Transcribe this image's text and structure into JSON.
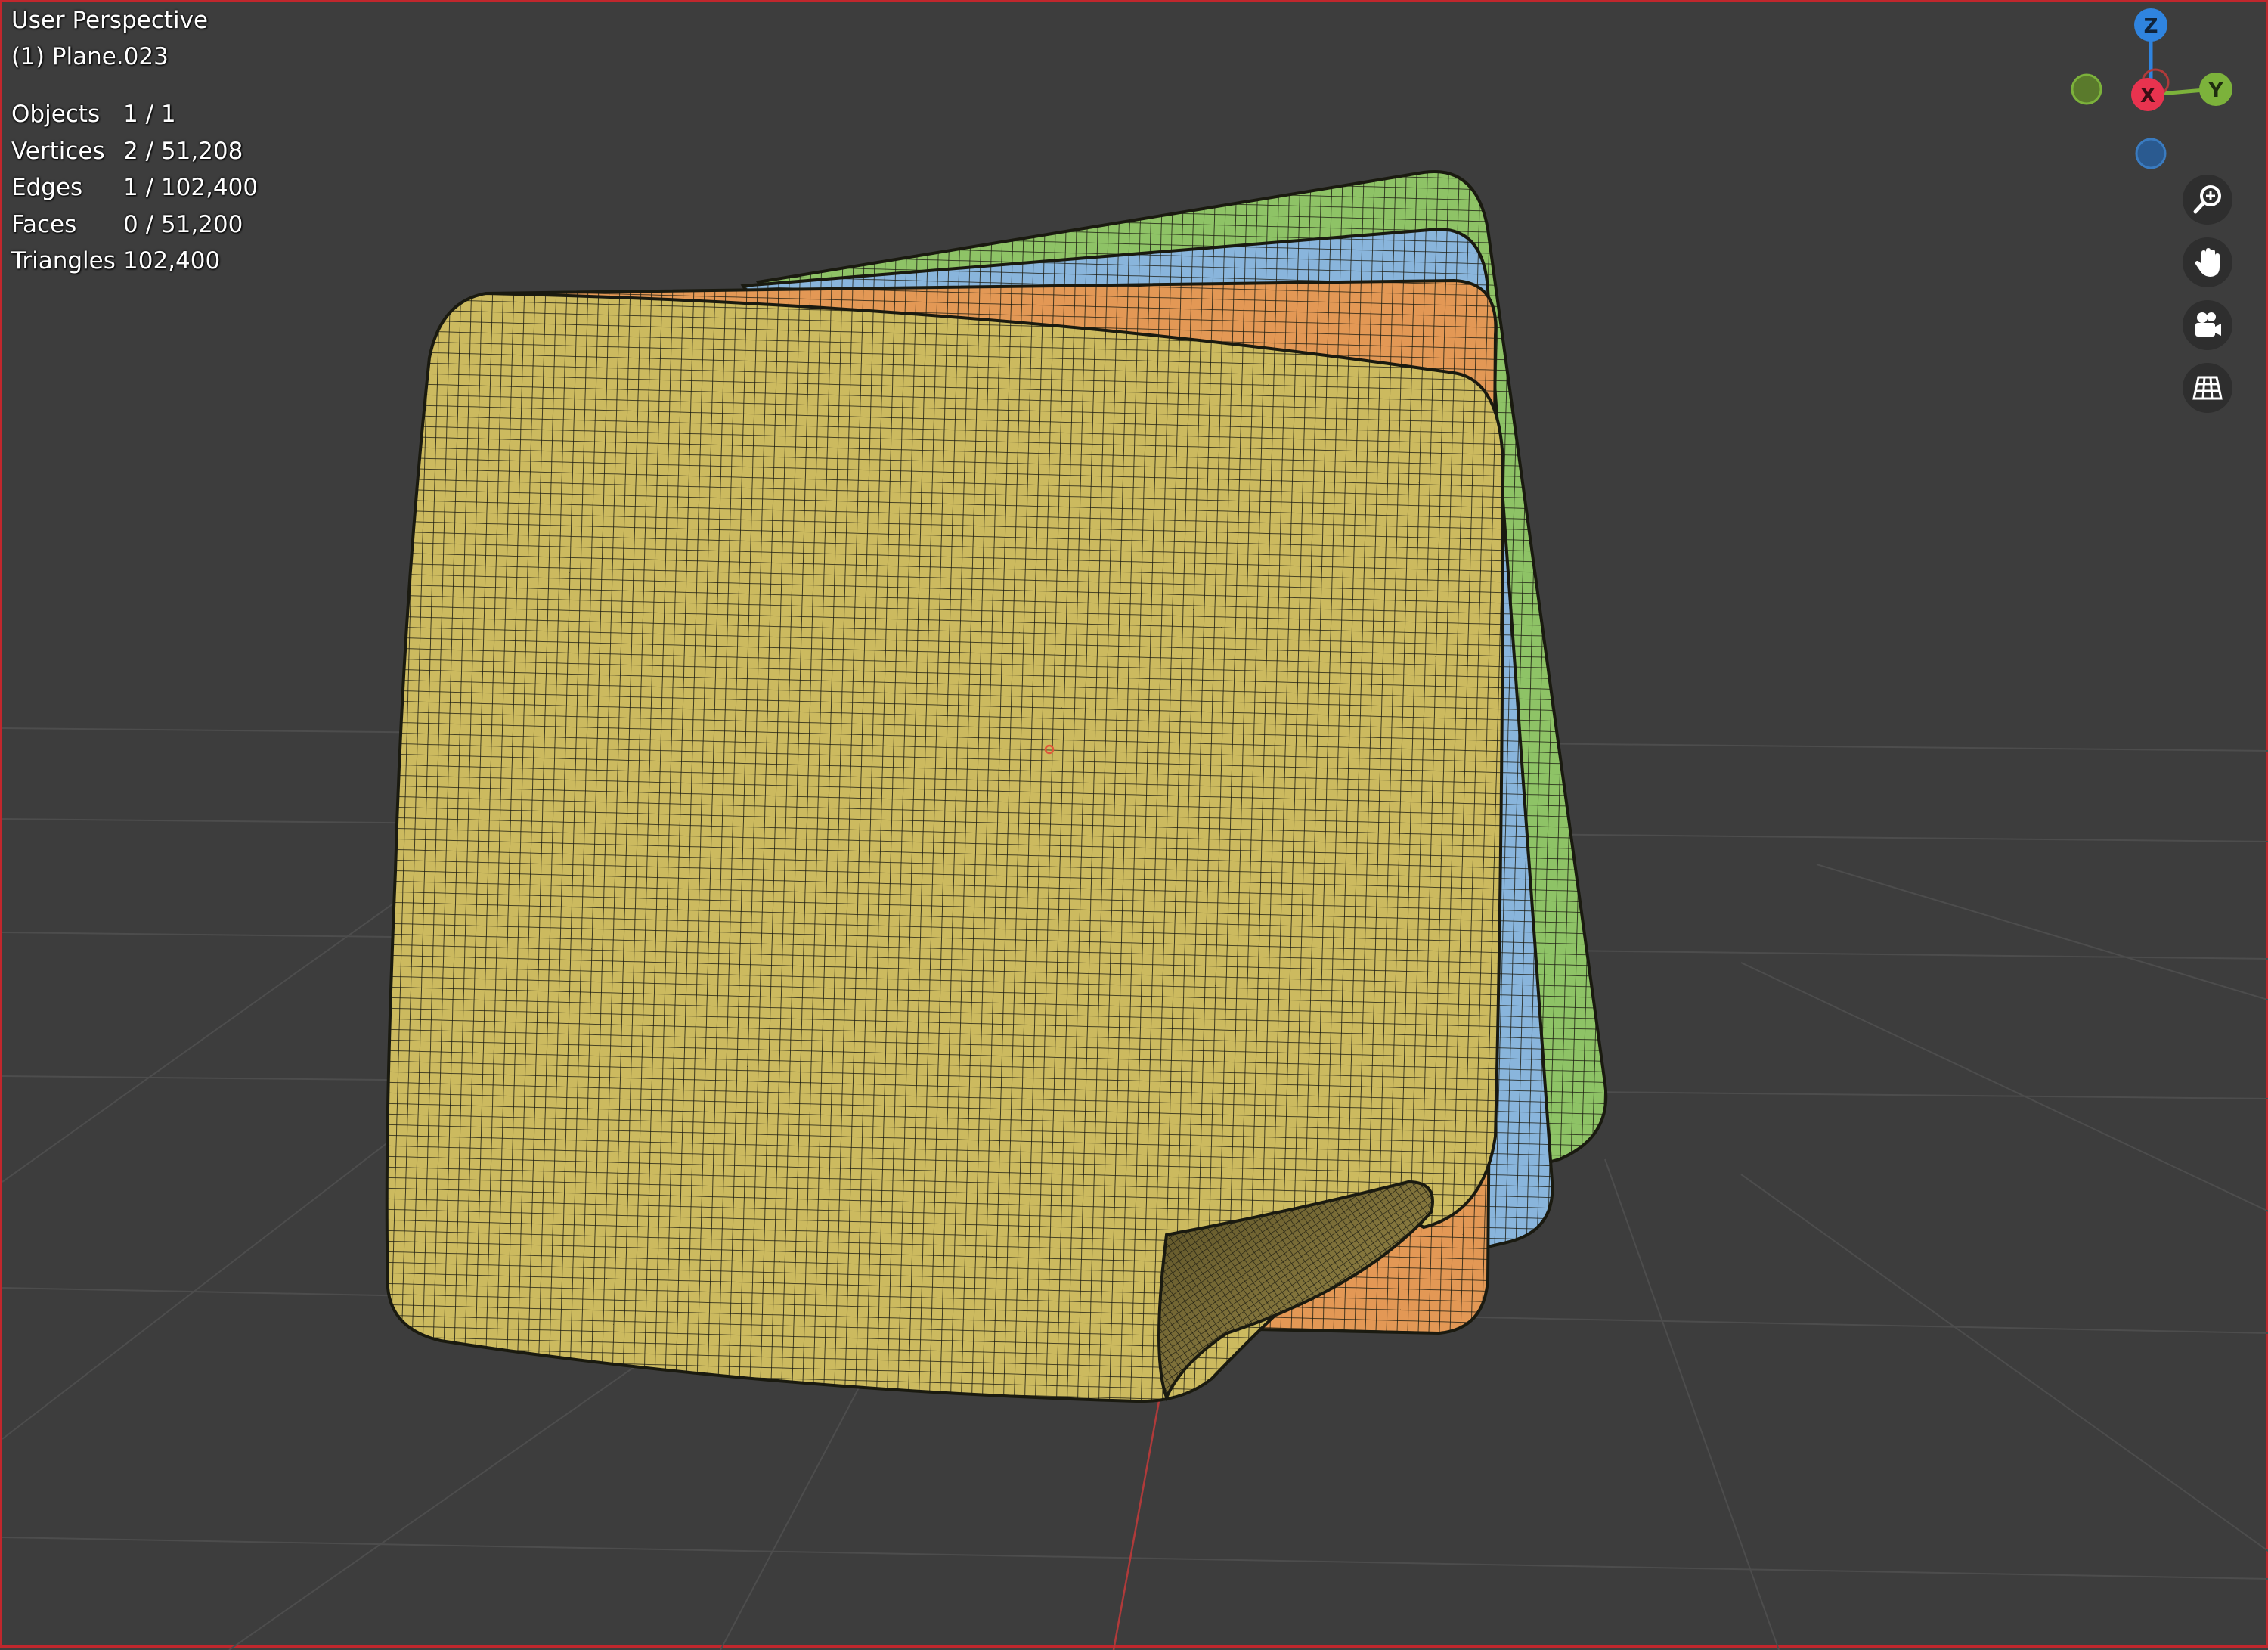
{
  "header": {
    "view_name": "User Perspective",
    "object_name": "(1) Plane.023"
  },
  "stats": [
    {
      "label": "Objects",
      "value": "1 / 1"
    },
    {
      "label": "Vertices",
      "value": "2 / 51,208"
    },
    {
      "label": "Edges",
      "value": "1 / 102,400"
    },
    {
      "label": "Faces",
      "value": "0 / 51,200"
    },
    {
      "label": "Triangles",
      "value": "102,400"
    }
  ],
  "gizmo": {
    "z_label": "Z",
    "y_label": "Y",
    "x_label": "X",
    "colors": {
      "x": "#e8334f",
      "y": "#7cb23b",
      "z": "#2f84e0",
      "neg_y": "#5a7a2c",
      "neg_z": "#2a5a90"
    }
  },
  "navigation": {
    "buttons": [
      "zoom-icon",
      "pan-hand-icon",
      "camera-icon",
      "grid-view-icon"
    ]
  },
  "cloth_colors": {
    "front": "#ccba5f",
    "orange": "#e39855",
    "blue": "#89b5dc",
    "green": "#8ec366"
  }
}
